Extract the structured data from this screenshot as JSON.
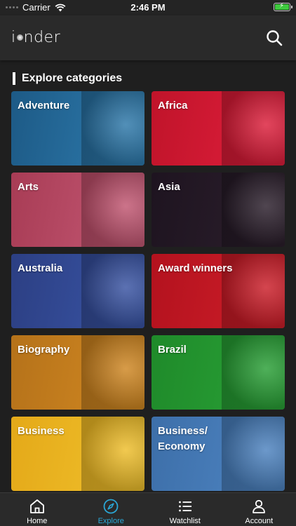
{
  "status_bar": {
    "carrier": "Carrier",
    "time": "2:46 PM",
    "battery_icon": "battery-charging-icon",
    "wifi_icon": "wifi-icon"
  },
  "header": {
    "logo_text_left": "i",
    "logo_text_right": "nder",
    "search_icon": "search-icon"
  },
  "section": {
    "title": "Explore categories"
  },
  "categories": [
    {
      "label": "Adventure",
      "color_a": "#1d5a86",
      "color_b": "#2f7db0"
    },
    {
      "label": "Africa",
      "color_a": "#c0142a",
      "color_b": "#e21f3d"
    },
    {
      "label": "Arts",
      "color_a": "#a83c55",
      "color_b": "#c65a76"
    },
    {
      "label": "Asia",
      "color_a": "#1e1420",
      "color_b": "#2c1f2c"
    },
    {
      "label": "Australia",
      "color_a": "#2c3f83",
      "color_b": "#3a56a8"
    },
    {
      "label": "Award winners",
      "color_a": "#b3121e",
      "color_b": "#d01f2a"
    },
    {
      "label": "Biography",
      "color_a": "#b5721a",
      "color_b": "#d48a22"
    },
    {
      "label": "Brazil",
      "color_a": "#1f8a2a",
      "color_b": "#2aa337"
    },
    {
      "label": "Business",
      "color_a": "#e4a919",
      "color_b": "#f1c22d"
    },
    {
      "label": "Business/\nEconomy",
      "color_a": "#3d6fa9",
      "color_b": "#4f86c4"
    }
  ],
  "bottom_nav": [
    {
      "label": "Home",
      "icon": "home-icon",
      "active": false
    },
    {
      "label": "Explore",
      "icon": "compass-icon",
      "active": true
    },
    {
      "label": "Watchlist",
      "icon": "list-icon",
      "active": false
    },
    {
      "label": "Account",
      "icon": "person-icon",
      "active": false
    }
  ],
  "colors": {
    "accent": "#2aa7d6",
    "background": "#1f1f1f",
    "header": "#2a2a2a"
  }
}
